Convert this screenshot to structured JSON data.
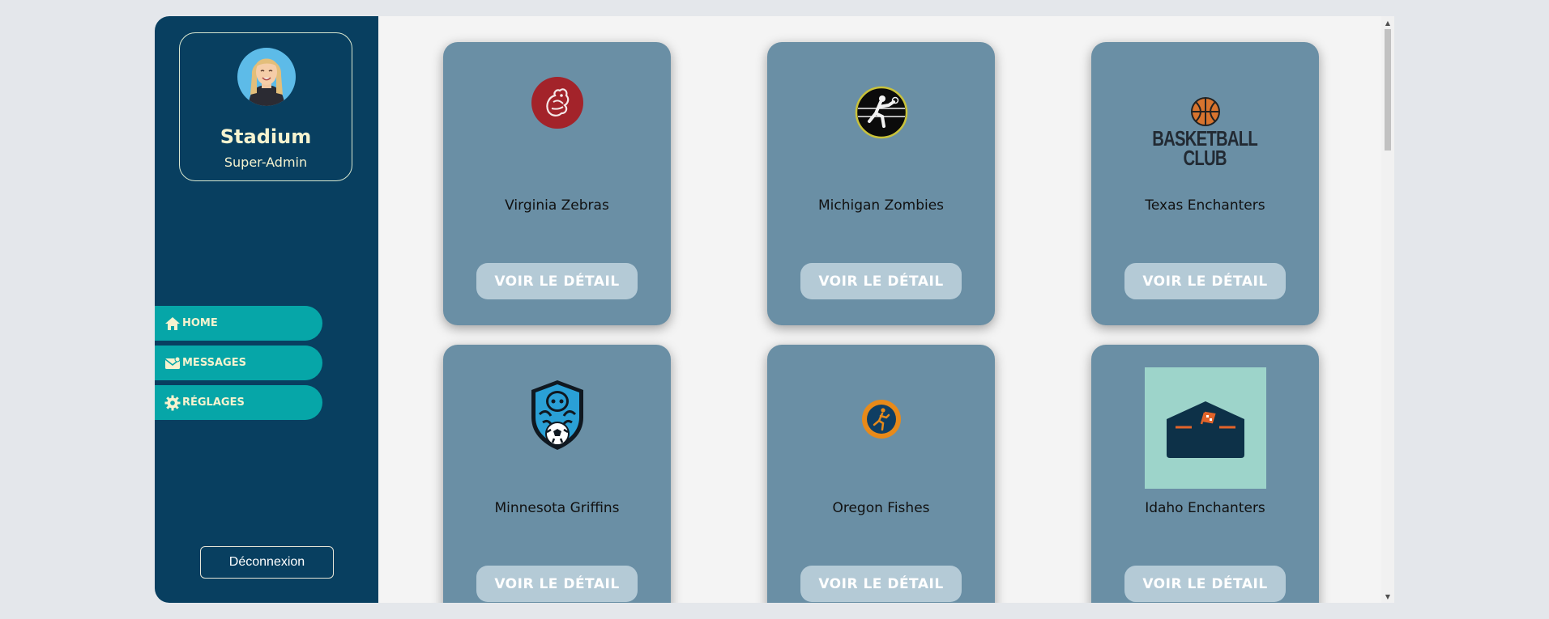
{
  "profile": {
    "name": "Stadium",
    "role": "Super-Admin"
  },
  "nav": {
    "items": [
      {
        "label": "HOME",
        "icon": "home-icon"
      },
      {
        "label": "MESSAGES",
        "icon": "envelope-icon"
      },
      {
        "label": "RÉGLAGES",
        "icon": "gear-icon"
      }
    ]
  },
  "logout_label": "Déconnexion",
  "teams": [
    {
      "name": "Virginia Zebras",
      "button": "VOIR LE DÉTAIL",
      "logo": "dragon-logo"
    },
    {
      "name": "Michigan Zombies",
      "button": "VOIR LE DÉTAIL",
      "logo": "tennis-player-logo"
    },
    {
      "name": "Texas Enchanters",
      "button": "VOIR LE DÉTAIL",
      "logo": "basketball-club-logo",
      "logo_text": [
        "BASKETBALL",
        "CLUB"
      ]
    },
    {
      "name": "Minnesota Griffins",
      "button": "VOIR LE DÉTAIL",
      "logo": "octopus-soccer-logo"
    },
    {
      "name": "Oregon Fishes",
      "button": "VOIR LE DÉTAIL",
      "logo": "runner-logo"
    },
    {
      "name": "Idaho Enchanters",
      "button": "VOIR LE DÉTAIL",
      "logo": "racing-flag-logo"
    }
  ],
  "colors": {
    "sidebar": "#083f60",
    "nav_item": "#06a6a8",
    "card": "#6a8fa5",
    "card_button": "#b4cad6",
    "accent_text": "#f6f3cf"
  }
}
